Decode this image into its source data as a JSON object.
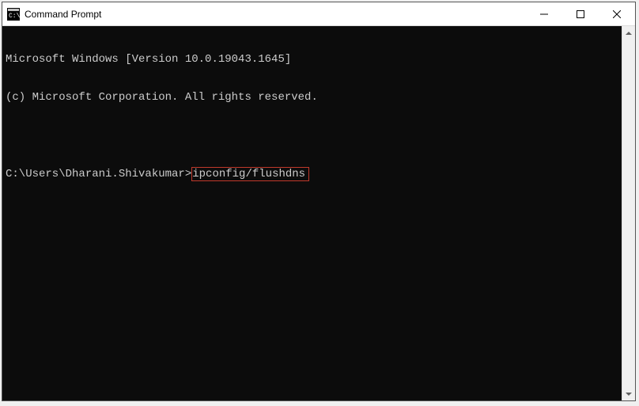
{
  "window": {
    "title": "Command Prompt"
  },
  "terminal": {
    "line1": "Microsoft Windows [Version 10.0.19043.1645]",
    "line2": "(c) Microsoft Corporation. All rights reserved.",
    "prompt": "C:\\Users\\Dharani.Shivakumar>",
    "command": "ipconfig/flushdns"
  },
  "icons": {
    "app": "cmd-icon",
    "minimize": "minimize-icon",
    "maximize": "maximize-icon",
    "close": "close-icon",
    "scroll_up": "scroll-up-icon",
    "scroll_down": "scroll-down-icon"
  }
}
